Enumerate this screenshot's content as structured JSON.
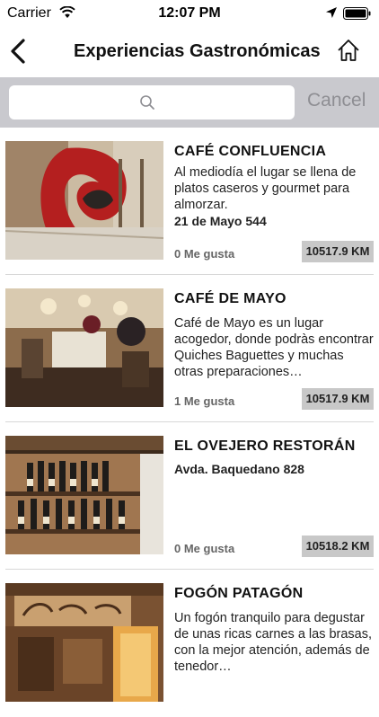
{
  "status_bar": {
    "carrier": "Carrier",
    "time": "12:07 PM"
  },
  "nav": {
    "title": "Experiencias Gastronómicas",
    "back_icon": "chevron-left-icon",
    "home_icon": "home-icon"
  },
  "search": {
    "placeholder": "",
    "cancel_label": "Cancel"
  },
  "items": [
    {
      "title": "CAFÉ CONFLUENCIA",
      "description": "Al mediodía el lugar se llena de platos caseros y gourmet para almorzar.",
      "address": "21 de Mayo 544",
      "likes": "0 Me gusta",
      "distance": "10517.9 KM"
    },
    {
      "title": "CAFÉ DE MAYO",
      "description": "Café de Mayo es un lugar acogedor, donde podràs encontrar Quiches Baguettes y muchas otras preparaciones…",
      "address": "",
      "likes": "1 Me gusta",
      "distance": "10517.9 KM"
    },
    {
      "title": "EL OVEJERO RESTORÁN",
      "description": "",
      "address": "Avda. Baquedano 828",
      "likes": "0 Me gusta",
      "distance": "10518.2 KM"
    },
    {
      "title": "FOGÓN PATAGÓN",
      "description": "Un fogón tranquilo para degustar de unas ricas carnes a las brasas, con la mejor atención, además de tenedor…",
      "address": "",
      "likes": "",
      "distance": ""
    }
  ]
}
